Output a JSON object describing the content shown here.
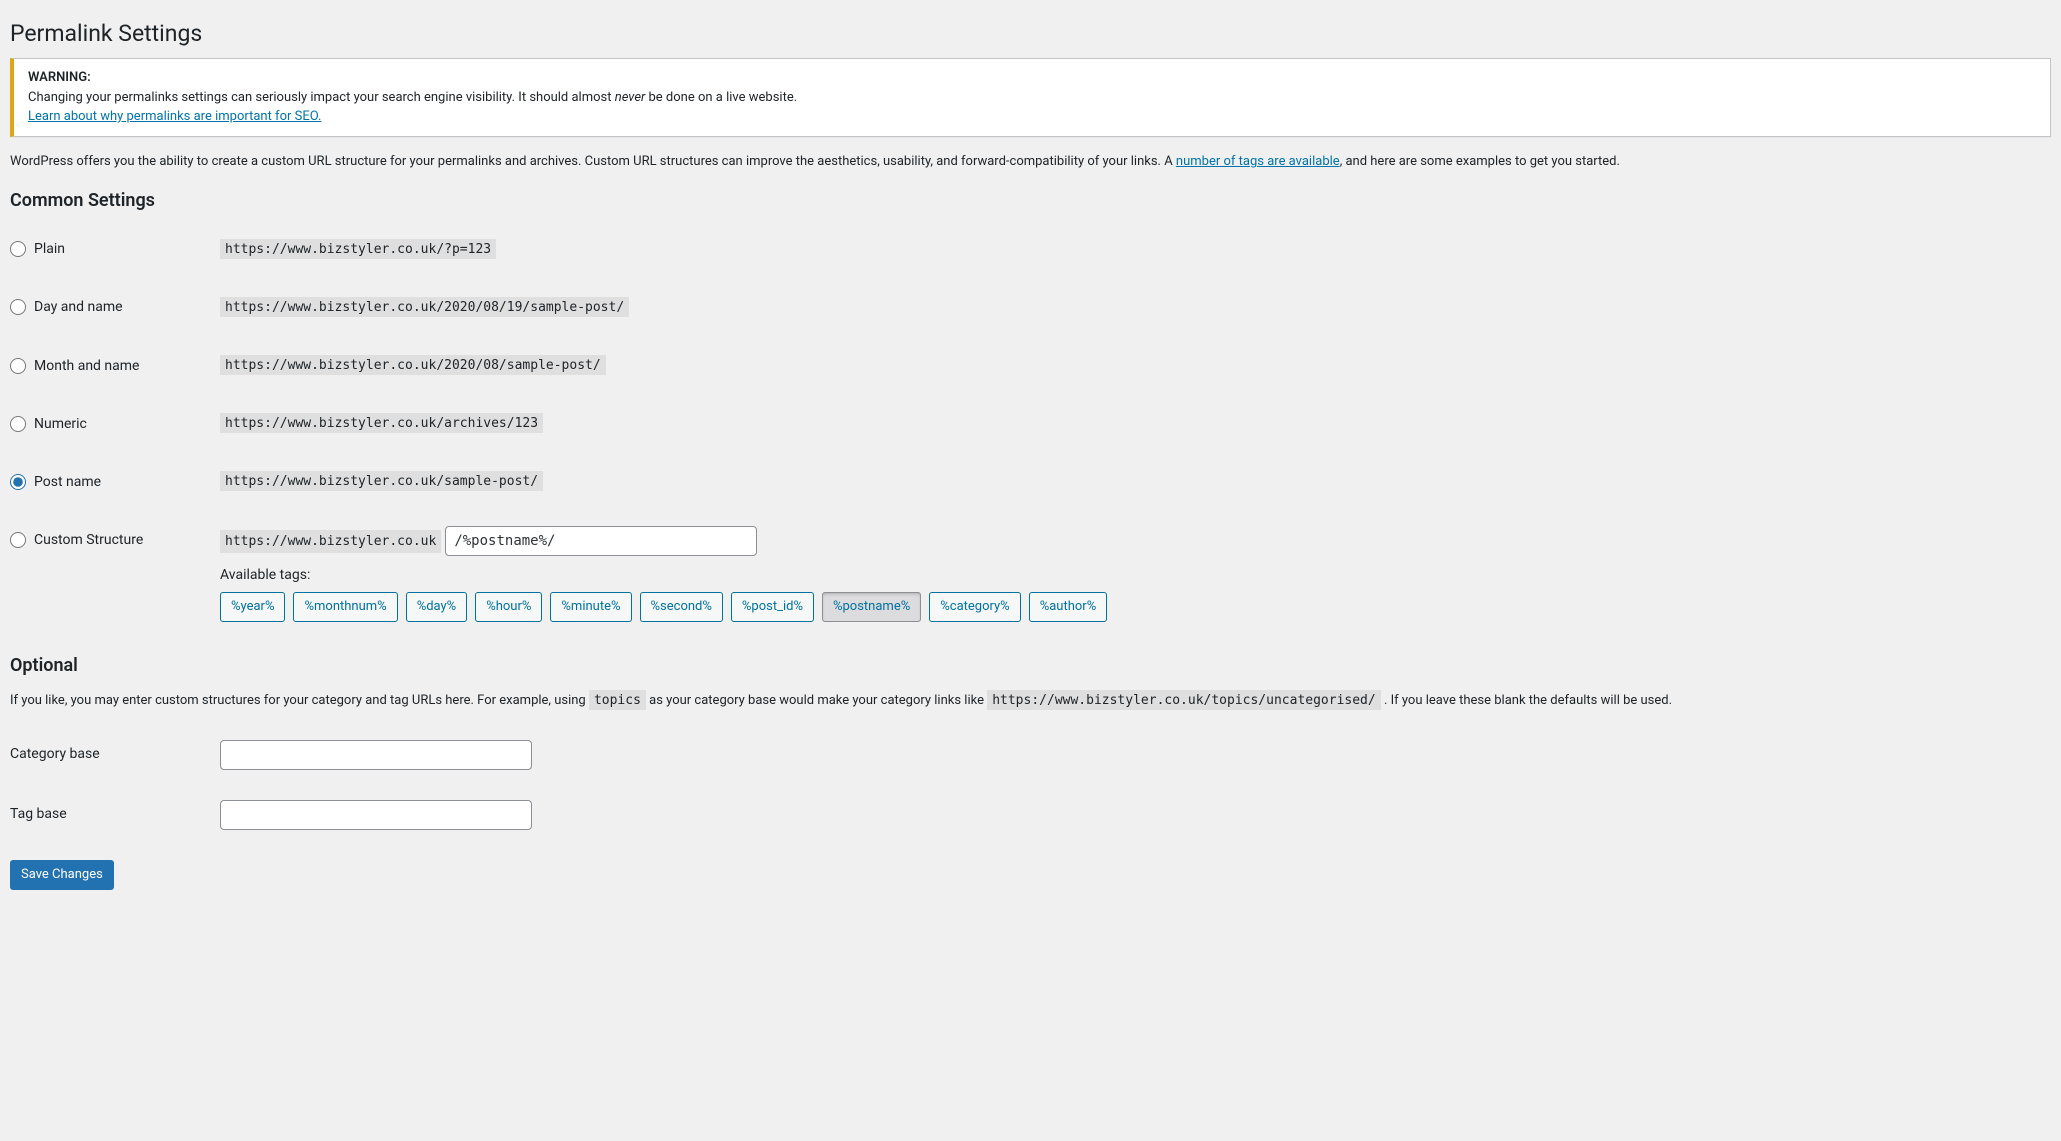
{
  "page": {
    "title": "Permalink Settings"
  },
  "warning": {
    "label": "WARNING:",
    "text_before": "Changing your permalinks settings can seriously impact your search engine visibility. It should almost ",
    "text_em": "never",
    "text_after": " be done on a live website.",
    "link_text": "Learn about why permalinks are important for SEO."
  },
  "intro": {
    "text_before": "WordPress offers you the ability to create a custom URL structure for your permalinks and archives. Custom URL structures can improve the aesthetics, usability, and forward-compatibility of your links. A ",
    "link_text": "number of tags are available",
    "text_after": ", and here are some examples to get you started."
  },
  "common": {
    "heading": "Common Settings",
    "options": [
      {
        "label": "Plain",
        "example": "https://www.bizstyler.co.uk/?p=123",
        "checked": false
      },
      {
        "label": "Day and name",
        "example": "https://www.bizstyler.co.uk/2020/08/19/sample-post/",
        "checked": false
      },
      {
        "label": "Month and name",
        "example": "https://www.bizstyler.co.uk/2020/08/sample-post/",
        "checked": false
      },
      {
        "label": "Numeric",
        "example": "https://www.bizstyler.co.uk/archives/123",
        "checked": false
      },
      {
        "label": "Post name",
        "example": "https://www.bizstyler.co.uk/sample-post/",
        "checked": true
      }
    ],
    "custom": {
      "label": "Custom Structure",
      "prefix": "https://www.bizstyler.co.uk",
      "value": "/%postname%/",
      "available_label": "Available tags:",
      "tags": [
        "%year%",
        "%monthnum%",
        "%day%",
        "%hour%",
        "%minute%",
        "%second%",
        "%post_id%",
        "%postname%",
        "%category%",
        "%author%"
      ],
      "active_tag": "%postname%"
    }
  },
  "optional": {
    "heading": "Optional",
    "text_before": "If you like, you may enter custom structures for your category and tag URLs here. For example, using ",
    "code_1": "topics",
    "text_mid": " as your category base would make your category links like ",
    "code_2": "https://www.bizstyler.co.uk/topics/uncategorised/",
    "text_after": " . If you leave these blank the defaults will be used.",
    "category_label": "Category base",
    "category_value": "",
    "tag_label": "Tag base",
    "tag_value": ""
  },
  "submit": {
    "label": "Save Changes"
  }
}
